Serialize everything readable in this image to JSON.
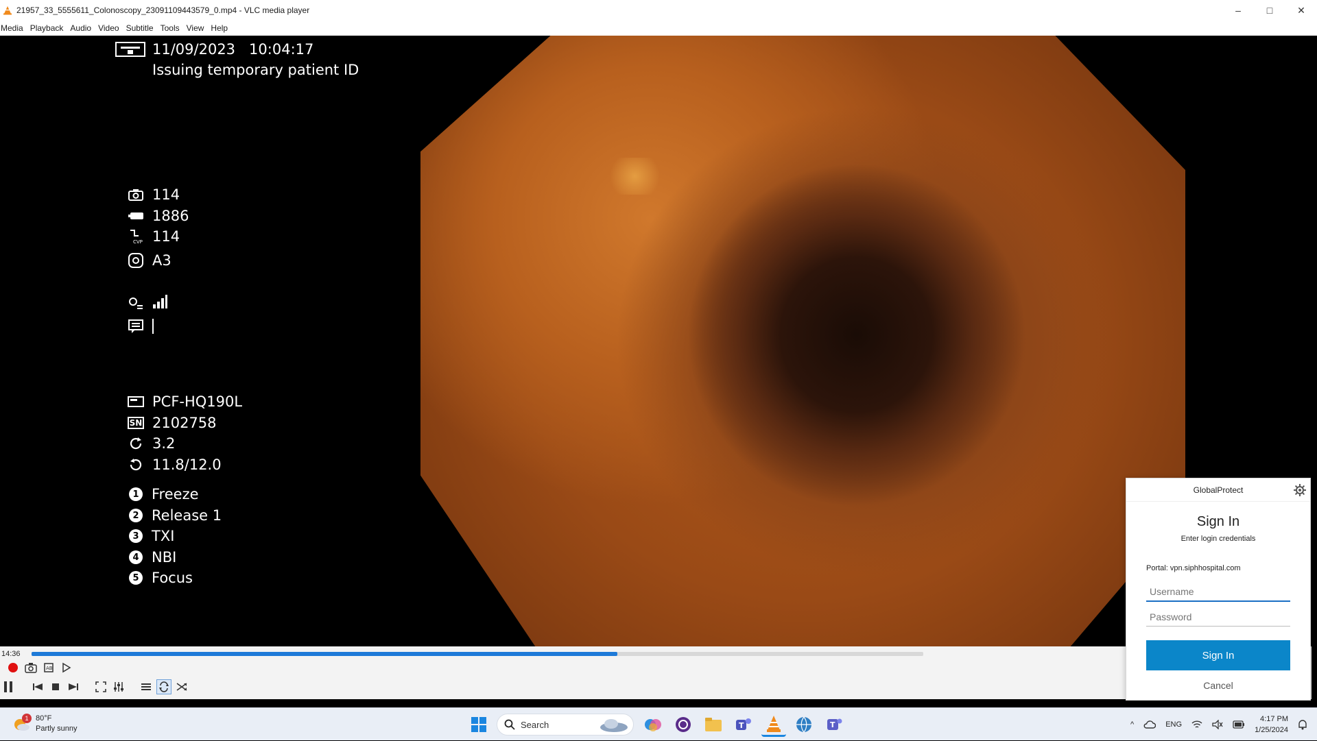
{
  "window": {
    "title": "21957_33_5555611_Colonoscopy_23091109443579_0.mp4 - VLC media player",
    "controls": [
      "–",
      "□",
      "✕"
    ]
  },
  "menu": [
    "Media",
    "Playback",
    "Audio",
    "Video",
    "Subtitle",
    "Tools",
    "View",
    "Help"
  ],
  "osd": {
    "date": "11/09/2023",
    "time": "10:04:17",
    "patient": "Issuing temporary patient ID",
    "stats": [
      {
        "icon": "camera-icon",
        "value": "114"
      },
      {
        "icon": "battery-icon",
        "value": "1886"
      },
      {
        "icon": "cvp-icon",
        "value": "114"
      },
      {
        "icon": "iris-icon",
        "value": "A3"
      }
    ],
    "scope": {
      "model": "PCF-HQ190L",
      "sn_label": "SN",
      "serial": "2102758",
      "val1": "3.2",
      "val2": "11.8/12.0"
    },
    "functions": [
      {
        "num": "1",
        "label": "Freeze"
      },
      {
        "num": "2",
        "label": "Release 1"
      },
      {
        "num": "3",
        "label": "TXI"
      },
      {
        "num": "4",
        "label": "NBI"
      },
      {
        "num": "5",
        "label": "Focus"
      }
    ]
  },
  "player": {
    "elapsed": "14:36",
    "progress": 0.657
  },
  "globalprotect": {
    "header": "GlobalProtect",
    "title": "Sign In",
    "subtitle": "Enter login credentials",
    "portal": "Portal: vpn.siphhospital.com",
    "username_placeholder": "Username",
    "password_placeholder": "Password",
    "signin_label": "Sign In",
    "cancel_label": "Cancel"
  },
  "taskbar": {
    "temp": "80°F",
    "weather": "Partly sunny",
    "weather_badge": "1",
    "search": "Search",
    "lang": "ENG",
    "time": "4:17 PM",
    "date": "1/25/2024"
  }
}
